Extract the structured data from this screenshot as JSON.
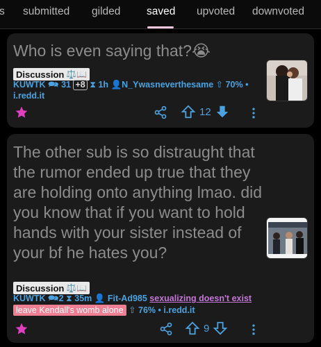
{
  "tabs": [
    {
      "label": "s",
      "active": false
    },
    {
      "label": "submitted",
      "active": false
    },
    {
      "label": "gilded",
      "active": false
    },
    {
      "label": "saved",
      "active": true
    },
    {
      "label": "upvoted",
      "active": false
    },
    {
      "label": "downvoted",
      "active": false
    }
  ],
  "posts": [
    {
      "title": "Who is even saying that?😭",
      "flair": "Discussion",
      "flair_emoji": "⚖️📖",
      "subreddit": "KUWTK",
      "comments": "31",
      "new_comments": "+8",
      "age": "1h",
      "author": "N_Ywasneverthesame",
      "upvote_ratio": "70%",
      "domain": "i.redd.it",
      "score": "12"
    },
    {
      "title": "The other sub is so distraught that the rumor ended up true that they are holding onto anything lmao. did you know that if you want to hold hands with your sister instead of your bf he hates you?",
      "flair": "Discussion",
      "flair_emoji": "⚖️📖",
      "subreddit": "KUWTK",
      "comments": "2",
      "age": "35m",
      "author": "Fit-Ad985",
      "user_flair": "sexualizing doesn't exist",
      "author_flair": "leave Kendall's womb alone",
      "upvote_ratio": "76%",
      "domain": "i.redd.it",
      "score": "9"
    }
  ],
  "colors": {
    "accent_blue": "#4aa3e0",
    "star_pink": "#e040c0",
    "flair_pink": "#f07f94",
    "user_flair_purple": "#c576d8",
    "active_tab_underline": "#f2c6dc"
  }
}
